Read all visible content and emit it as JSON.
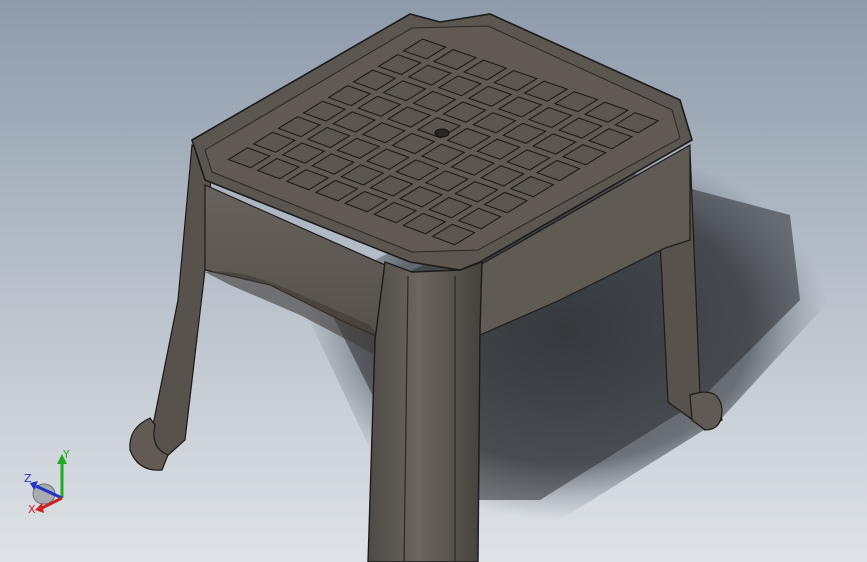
{
  "viewport": {
    "background_top": "#8e9bab",
    "background_bottom": "#dfe3e7"
  },
  "model": {
    "body_color": "#5b5650",
    "edge_color": "#1d1b19",
    "highlight_color": "#77716a",
    "grid_rows": 8,
    "grid_cols": 8
  },
  "triad": {
    "x_label": "X",
    "y_label": "Y",
    "z_label": "Z",
    "x_color": "#cc2222",
    "y_color": "#22aa22",
    "z_color": "#2233cc"
  }
}
